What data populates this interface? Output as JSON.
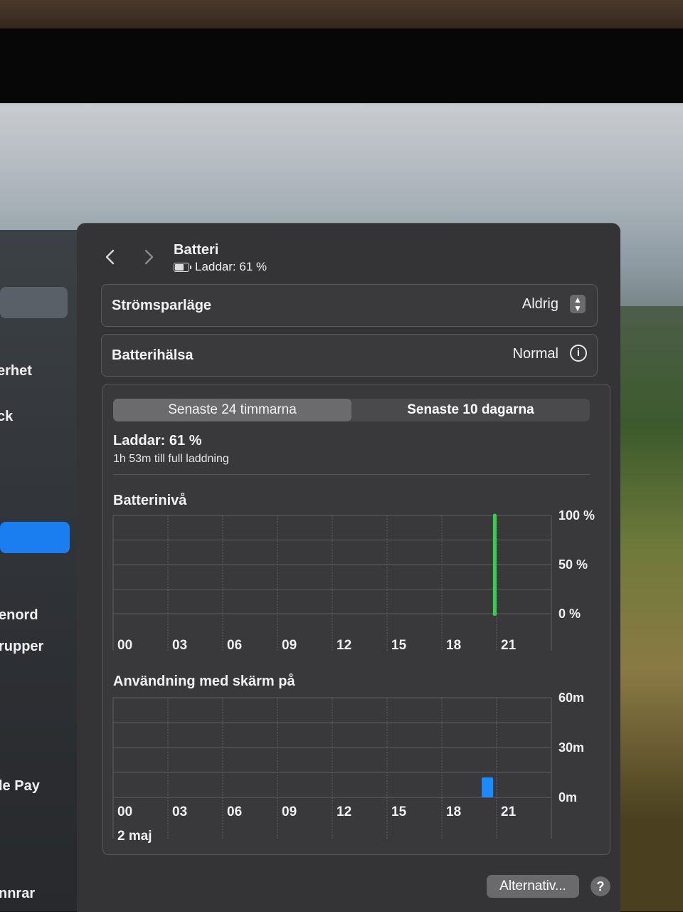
{
  "sidebar": {
    "items": [
      {
        "label": "erhet"
      },
      {
        "label": "ck"
      },
      {
        "label": "enord"
      },
      {
        "label": "rupper"
      },
      {
        "label": "le Pay"
      },
      {
        "label": "nnrar"
      }
    ]
  },
  "header": {
    "title": "Batteri",
    "status": "Laddar: 61 %"
  },
  "power_mode": {
    "label": "Strömsparläge",
    "value": "Aldrig"
  },
  "battery_health": {
    "label": "Batterihälsa",
    "value": "Normal"
  },
  "tabs": [
    {
      "label": "Senaste 24 timmarna",
      "selected": true
    },
    {
      "label": "Senaste 10 dagarna",
      "selected": false
    }
  ],
  "charge": {
    "title": "Laddar: 61 %",
    "subtitle": "1h 53m till full laddning"
  },
  "colors": {
    "battery_line": "#35d04a",
    "usage_bar": "#1a8cff"
  },
  "chart_data": [
    {
      "type": "bar",
      "title": "Batterinivå",
      "categories": [
        "00",
        "03",
        "06",
        "09",
        "12",
        "15",
        "18",
        "21"
      ],
      "ytick_labels": [
        "100 %",
        "50 %",
        "0 %"
      ],
      "ylim": [
        0,
        100
      ],
      "series": [
        {
          "x": [
            20.9,
            21.0
          ],
          "values": [
            0,
            100
          ]
        }
      ],
      "grid": true
    },
    {
      "type": "bar",
      "title": "Användning med skärm på",
      "categories": [
        "00",
        "03",
        "06",
        "09",
        "12",
        "15",
        "18",
        "21"
      ],
      "date_label": "2 maj",
      "ytick_labels": [
        "60m",
        "30m",
        "0m"
      ],
      "ylim": [
        0,
        60
      ],
      "series": [
        {
          "x": [
            20.5
          ],
          "values": [
            12
          ]
        }
      ],
      "grid": true
    }
  ],
  "footer": {
    "options_label": "Alternativ...",
    "help_label": "?"
  }
}
